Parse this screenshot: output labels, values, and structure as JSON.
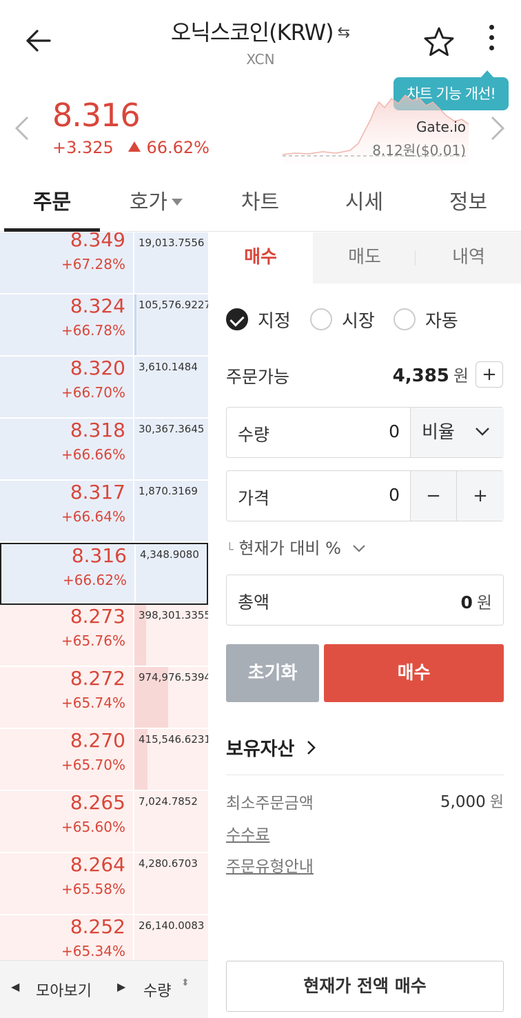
{
  "header": {
    "title": "오닉스코인(KRW)",
    "swap_glyph": "⇆",
    "subtitle": "XCN",
    "tooltip": "차트 기능 개선!"
  },
  "price_info": {
    "price": "8.316",
    "change_abs": "+3.325",
    "change_pct": "66.62%",
    "exchange": "Gate.io",
    "exchange_price": "8.12원($0.01)",
    "color_up": "#d9463a"
  },
  "tabs": [
    {
      "label": "주문"
    },
    {
      "label": "호가"
    },
    {
      "label": "차트"
    },
    {
      "label": "시세"
    },
    {
      "label": "정보"
    }
  ],
  "orderbook": {
    "sell": [
      {
        "price": "8.349",
        "rate": "+67.28%",
        "qty": "19,013.7556",
        "bar": 0.0
      },
      {
        "price": "8.324",
        "rate": "+66.78%",
        "qty": "105,576.9227",
        "bar": 0.03
      },
      {
        "price": "8.320",
        "rate": "+66.70%",
        "qty": "3,610.1484",
        "bar": 0.0
      },
      {
        "price": "8.318",
        "rate": "+66.66%",
        "qty": "30,367.3645",
        "bar": 0.0
      },
      {
        "price": "8.317",
        "rate": "+66.64%",
        "qty": "1,870.3169",
        "bar": 0.0
      },
      {
        "price": "8.316",
        "rate": "+66.62%",
        "qty": "4,348.9080",
        "bar": 0.0
      }
    ],
    "buy": [
      {
        "price": "8.273",
        "rate": "+65.76%",
        "qty": "398,301.3355",
        "bar": 0.16
      },
      {
        "price": "8.272",
        "rate": "+65.74%",
        "qty": "974,976.5394",
        "bar": 0.46
      },
      {
        "price": "8.270",
        "rate": "+65.70%",
        "qty": "415,546.6231",
        "bar": 0.18
      },
      {
        "price": "8.265",
        "rate": "+65.60%",
        "qty": "7,024.7852",
        "bar": 0.0
      },
      {
        "price": "8.264",
        "rate": "+65.58%",
        "qty": "4,280.6703",
        "bar": 0.0
      },
      {
        "price": "8.252",
        "rate": "+65.34%",
        "qty": "26,140.0083",
        "bar": 0.0
      }
    ],
    "footer": {
      "prev": "◀",
      "label": "모아보기",
      "next": "▶",
      "qty_label": "수량",
      "sort": "⬍"
    }
  },
  "order_form": {
    "side_tabs": [
      {
        "label": "매수"
      },
      {
        "label": "매도"
      },
      {
        "label": "내역"
      }
    ],
    "types": [
      {
        "label": "지정"
      },
      {
        "label": "시장"
      },
      {
        "label": "자동"
      }
    ],
    "available_label": "주문가능",
    "available_value": "4,385",
    "currency": "원",
    "plus": "+",
    "quantity_label": "수량",
    "quantity_value": "0",
    "ratio_label": "비율",
    "price_label": "가격",
    "price_value": "0",
    "minus": "−",
    "ratio_hint": "현재가 대비 %",
    "total_label": "총액",
    "total_value": "0",
    "reset_label": "초기화",
    "buy_label": "매수",
    "assets_label": "보유자산",
    "min_label": "최소주문금액",
    "min_value": "5,000",
    "fee_link": "수수료",
    "guide_link": "주문유형안내",
    "full_buy_label": "현재가 전액 매수"
  }
}
